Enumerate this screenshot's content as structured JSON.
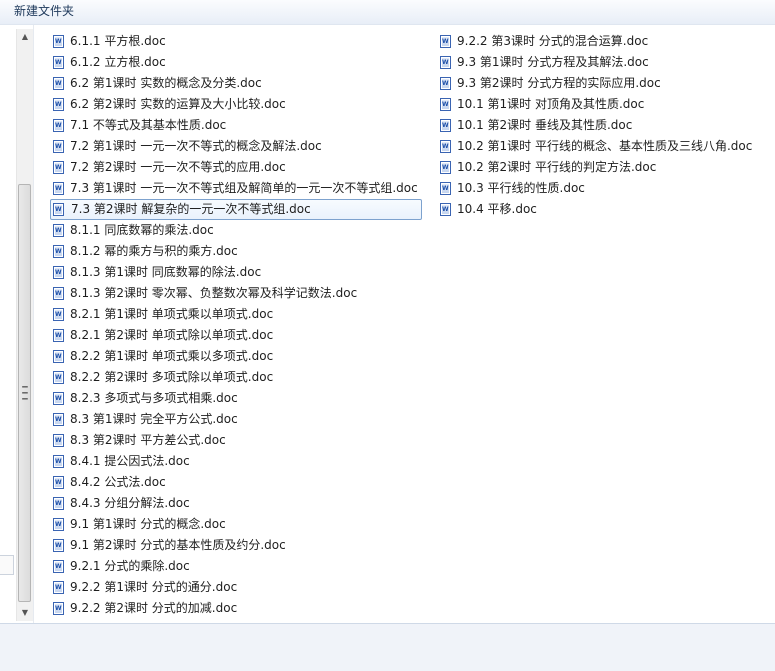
{
  "toolbar": {
    "new_folder_label": "新建文件夹"
  },
  "files": {
    "column1": [
      "6.1.1 平方根.doc",
      "6.1.2 立方根.doc",
      "6.2 第1课时  实数的概念及分类.doc",
      "6.2 第2课时  实数的运算及大小比较.doc",
      "7.1 不等式及其基本性质.doc",
      "7.2 第1课时  一元一次不等式的概念及解法.doc",
      "7.2 第2课时  一元一次不等式的应用.doc",
      "7.3 第1课时  一元一次不等式组及解简单的一元一次不等式组.doc",
      "7.3 第2课时  解复杂的一元一次不等式组.doc",
      "8.1.1 同底数幂的乘法.doc",
      "8.1.2 幂的乘方与积的乘方.doc",
      "8.1.3 第1课时  同底数幂的除法.doc",
      "8.1.3 第2课时  零次幂、负整数次幂及科学记数法.doc",
      "8.2.1 第1课时  单项式乘以单项式.doc",
      "8.2.1 第2课时  单项式除以单项式.doc",
      "8.2.2 第1课时  单项式乘以多项式.doc",
      "8.2.2 第2课时  多项式除以单项式.doc",
      "8.2.3 多项式与多项式相乘.doc",
      "8.3 第1课时  完全平方公式.doc",
      "8.3 第2课时  平方差公式.doc",
      "8.4.1 提公因式法.doc",
      "8.4.2 公式法.doc",
      "8.4.3 分组分解法.doc",
      "9.1 第1课时  分式的概念.doc",
      "9.1 第2课时  分式的基本性质及约分.doc",
      "9.2.1 分式的乘除.doc",
      "9.2.2 第1课时  分式的通分.doc",
      "9.2.2 第2课时  分式的加减.doc"
    ],
    "column2": [
      "9.2.2 第3课时  分式的混合运算.doc",
      "9.3 第1课时  分式方程及其解法.doc",
      "9.3 第2课时  分式方程的实际应用.doc",
      "10.1 第1课时  对顶角及其性质.doc",
      "10.1 第2课时  垂线及其性质.doc",
      "10.2 第1课时  平行线的概念、基本性质及三线八角.doc",
      "10.2 第2课时  平行线的判定方法.doc",
      "10.3 平行线的性质.doc",
      "10.4 平移.doc"
    ],
    "selected": "7.3 第2课时  解复杂的一元一次不等式组.doc"
  },
  "icons": {
    "file_icon": "word-doc-icon",
    "grip_icon": "scroll-grip-icon"
  },
  "colors": {
    "selection_border": "#7da2ce",
    "doc_icon_blue": "#3a64b2"
  }
}
